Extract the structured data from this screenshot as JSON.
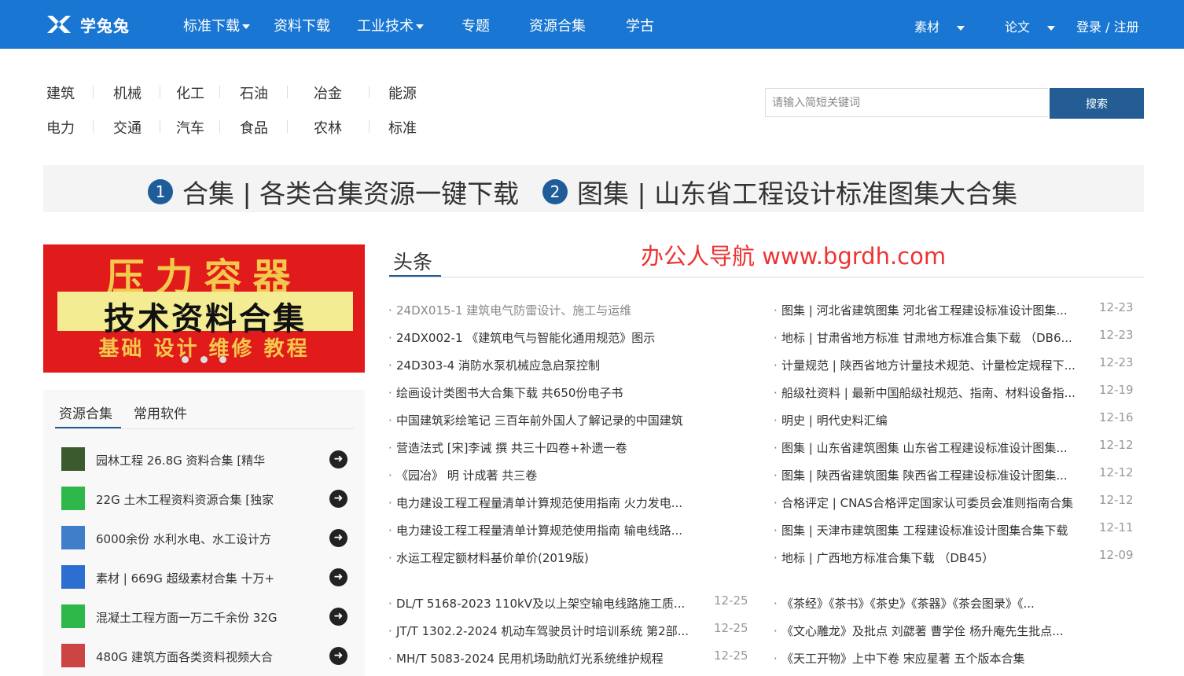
{
  "header": {
    "logo_text": "学兔兔",
    "nav": [
      {
        "label": "标准下载",
        "dropdown": true
      },
      {
        "label": "资料下载",
        "dropdown": false
      },
      {
        "label": "工业技术",
        "dropdown": true
      },
      {
        "label": "专题",
        "dropdown": false
      },
      {
        "label": "资源合集",
        "dropdown": false
      },
      {
        "label": "学古",
        "dropdown": false
      }
    ],
    "right_nav": [
      {
        "label": "素材",
        "dropdown": true
      },
      {
        "label": "论文",
        "dropdown": true
      }
    ],
    "login": "登录 / 注册",
    "bg_color": "#1976d2"
  },
  "categories": [
    "建筑",
    "机械",
    "化工",
    "石油",
    "冶金",
    "能源",
    "电力",
    "交通",
    "汽车",
    "食品",
    "农林",
    "标准"
  ],
  "search": {
    "placeholder": "请输入简短关键词",
    "button": "搜索"
  },
  "banner": {
    "items": [
      {
        "num": "1",
        "text": "合集 | 各类合集资源一键下载"
      },
      {
        "num": "2",
        "text": "图集 | 山东省工程设计标准图集大合集"
      }
    ]
  },
  "carousel": {
    "line1": "压力容器",
    "line2": "技术资料合集",
    "line3": "基础 设计 维修 教程",
    "slides": 3
  },
  "left_panel": {
    "tabs": [
      "资源合集",
      "常用软件"
    ],
    "items": [
      {
        "text": "园林工程 26.8G 资料合集 [精华",
        "thumb_color": "#3b5b2e"
      },
      {
        "text": "22G 土木工程资料资源合集 [独家",
        "thumb_color": "#2fb84a"
      },
      {
        "text": "6000余份 水利水电、水工设计方",
        "thumb_color": "#3f7fc9"
      },
      {
        "text": "素材 | 669G 超级素材合集 十万+",
        "thumb_color": "#2d6fd1"
      },
      {
        "text": "混凝土工程方面一万二千余份 32G",
        "thumb_color": "#2fb84a"
      },
      {
        "text": "480G 建筑方面各类资料视频大合",
        "thumb_color": "#c44"
      }
    ]
  },
  "headline": {
    "tab": "头条",
    "watermark": "办公人导航 www.bgrdh.com",
    "left_col": [
      {
        "text": "24DX015-1 建筑电气防雷设计、施工与运维",
        "muted": true
      },
      {
        "text": "24DX002-1 《建筑电气与智能化通用规范》图示",
        "muted": false
      },
      {
        "text": "24D303-4 消防水泵机械应急启泵控制",
        "muted": false
      },
      {
        "text": "绘画设计类图书大合集下载 共650份电子书",
        "muted": false
      },
      {
        "text": "中国建筑彩绘笔记 三百年前外国人了解记录的中国建筑",
        "muted": false
      },
      {
        "text": "营造法式 [宋]李诫 撰 共三十四卷+补遗一卷",
        "muted": false
      },
      {
        "text": "《园冶》 明 计成著 共三卷",
        "muted": false
      },
      {
        "text": "电力建设工程工程量清单计算规范使用指南 火力发电...",
        "muted": false
      },
      {
        "text": "电力建设工程工程量清单计算规范使用指南 输电线路...",
        "muted": false
      },
      {
        "text": "水运工程定额材料基价单价(2019版)",
        "muted": false
      }
    ],
    "right_col": [
      {
        "text": "图集 | 河北省建筑图集 河北省工程建设标准设计图集...",
        "date": "12-23"
      },
      {
        "text": "地标 | 甘肃省地方标准 甘肃地方标准合集下载 （DB6...",
        "date": "12-23"
      },
      {
        "text": "计量规范 | 陕西省地方计量技术规范、计量检定规程下...",
        "date": "12-23"
      },
      {
        "text": "船级社资料 | 最新中国船级社规范、指南、材料设备指...",
        "date": "12-19"
      },
      {
        "text": "明史 | 明代史料汇编",
        "date": "12-16"
      },
      {
        "text": "图集 | 山东省建筑图集 山东省工程建设标准设计图集...",
        "date": "12-12"
      },
      {
        "text": "图集 | 陕西省建筑图集 陕西省工程建设标准设计图集...",
        "date": "12-12"
      },
      {
        "text": "合格评定 | CNAS合格评定国家认可委员会准则指南合集",
        "date": "12-12"
      },
      {
        "text": "图集 | 天津市建筑图集 工程建设标准设计图集合集下载",
        "date": "12-11"
      },
      {
        "text": "地标 | 广西地方标准合集下载 （DB45）",
        "date": "12-09"
      }
    ]
  },
  "second_block": {
    "left_col": [
      {
        "text": "DL/T 5168-2023 110kV及以上架空输电线路施工质...",
        "date": "12-25"
      },
      {
        "text": "JT/T 1302.2-2024 机动车驾驶员计时培训系统 第2部...",
        "date": "12-25"
      },
      {
        "text": "MH/T 5083-2024 民用机场助航灯光系统维护规程",
        "date": "12-25"
      }
    ],
    "right_col": [
      {
        "text": "《茶经》《茶书》《茶史》《茶器》《茶会图录》《..."
      },
      {
        "text": "《文心雕龙》及批点 刘勰著 曹学佺 杨升庵先生批点..."
      },
      {
        "text": "《天工开物》上中下卷 宋应星著 五个版本合集"
      }
    ]
  }
}
